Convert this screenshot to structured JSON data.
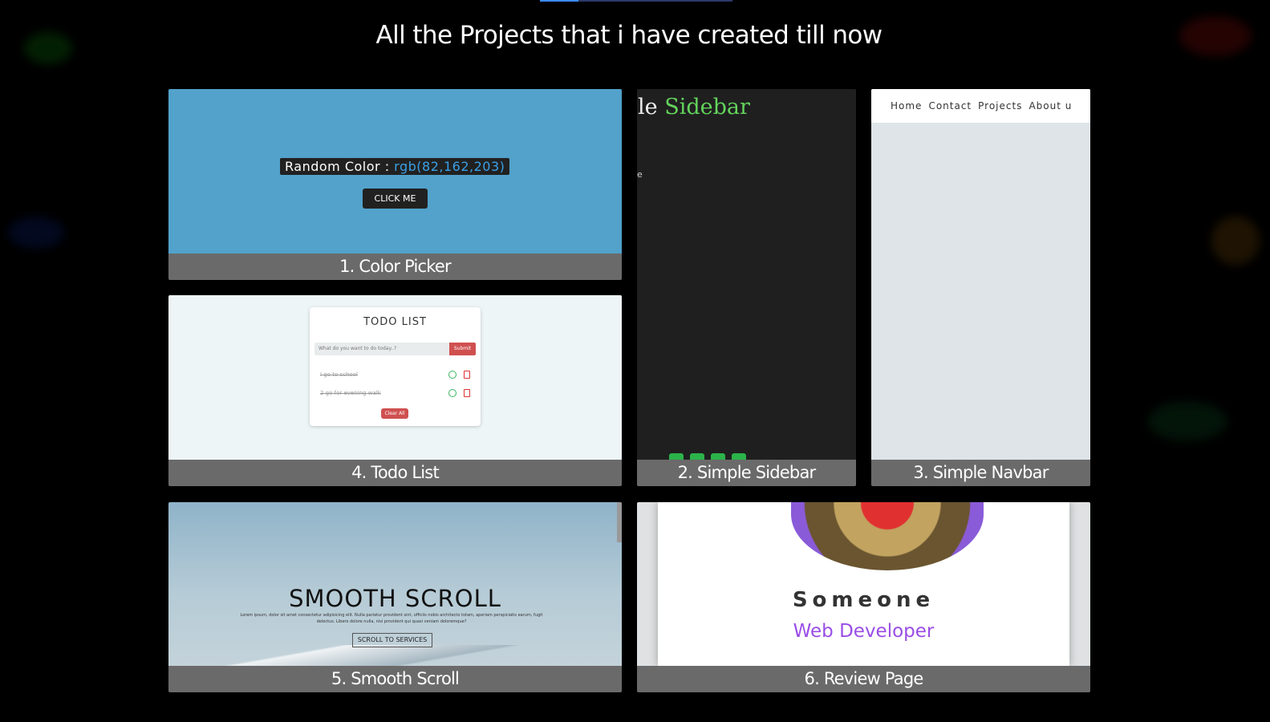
{
  "page": {
    "title": "All the Projects that i have created till now"
  },
  "projects": [
    {
      "caption": "1. Color Picker"
    },
    {
      "caption": "2. Simple Sidebar"
    },
    {
      "caption": "3. Simple Navbar"
    },
    {
      "caption": "4. Todo List"
    },
    {
      "caption": "5. Smooth Scroll"
    },
    {
      "caption": "6. Review Page"
    }
  ],
  "color_picker": {
    "label": "Random Color : ",
    "value": "rgb(82,162,203)",
    "button": "CLICK ME",
    "background": "#52a2cb"
  },
  "sidebar_preview": {
    "heading_prefix": "le ",
    "heading_accent": "Sidebar",
    "side_text": "e"
  },
  "navbar_preview": {
    "links": [
      "Home",
      "Contact",
      "Projects",
      "About u"
    ]
  },
  "todo_preview": {
    "title": "TODO LIST",
    "placeholder": "What do you want to do today..?",
    "submit": "Submit",
    "items": [
      "I go to school",
      "2 go for evening walk"
    ],
    "clear": "Clear All"
  },
  "scroll_preview": {
    "heading": "SMOOTH SCROLL",
    "body": "Lorem ipsum, dolor sit amet consectetur adipisicing elit. Nulla pariatur provident sint, officiis nobis architecto totam, aperiam perspiciatis earum, fugit delectus. Libero dolore nulla, nisi provident qui quasi veniam doloremque?",
    "button": "SCROLL TO SERVICES"
  },
  "review_preview": {
    "name": "Someone",
    "role": "Web Developer"
  },
  "colors": {
    "background": "#000000",
    "caption_bar": "#6b6a6a",
    "accent_green": "#63d35c",
    "accent_purple": "#9a4de6"
  }
}
